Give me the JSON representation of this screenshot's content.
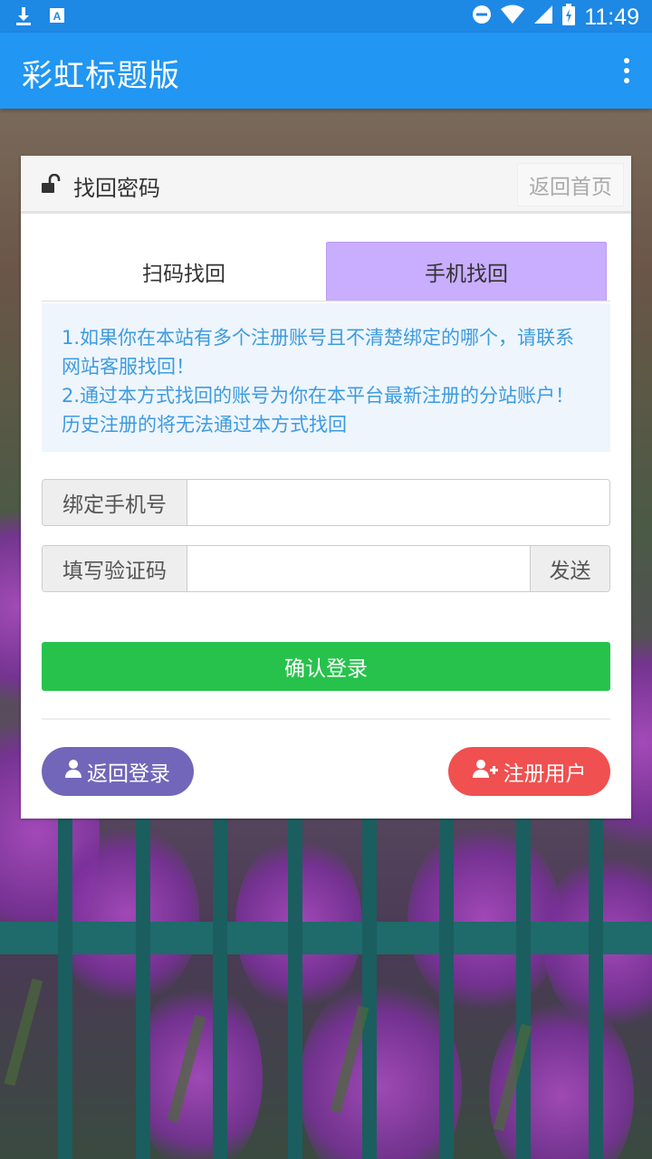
{
  "status_bar": {
    "time": "11:49",
    "icons_left": [
      "download-icon",
      "keyboard-icon"
    ],
    "icons_right": [
      "dnd-icon",
      "wifi-icon",
      "signal-icon",
      "battery-icon"
    ]
  },
  "app_bar": {
    "title": "彩虹标题版",
    "menu_icon": "overflow-menu-icon",
    "color": "#2196f3"
  },
  "card": {
    "header_title": "找回密码",
    "header_icon": "unlock-icon",
    "home_link": "返回首页"
  },
  "tabs": [
    {
      "label": "扫码找回",
      "active": false
    },
    {
      "label": "手机找回",
      "active": true,
      "color": "#c9adff"
    }
  ],
  "notice": {
    "line1": "1.如果你在本站有多个注册账号且不清楚绑定的哪个，请联系网站客服找回！",
    "line2": "2.通过本方式找回的账号为你在本平台最新注册的分站账户！历史注册的将无法通过本方式找回"
  },
  "form": {
    "phone_label": "绑定手机号",
    "phone_value": "",
    "code_label": "填写验证码",
    "code_value": "",
    "send_label": "发送"
  },
  "confirm": {
    "label": "确认登录",
    "color": "#27c24c"
  },
  "footer_buttons": {
    "back_label": "返回登录",
    "back_icon": "user-icon",
    "back_color": "#7266ba",
    "register_label": "注册用户",
    "register_icon": "user-plus-icon",
    "register_color": "#f05050"
  }
}
